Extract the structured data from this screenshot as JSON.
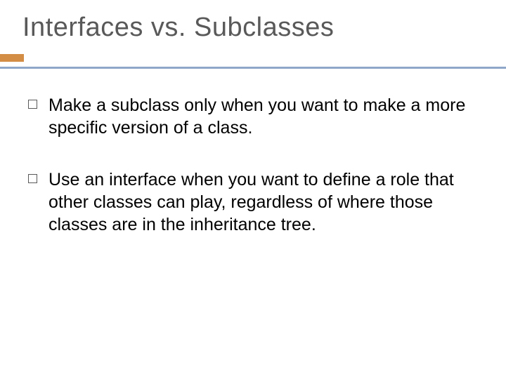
{
  "slide": {
    "title": "Interfaces vs. Subclasses",
    "bullets": [
      {
        "text": "Make a subclass only when you want to make a more specific version of a class."
      },
      {
        "text": "Use an interface when you want to define a role that other classes can play, regardless of where those classes are in the inheritance tree."
      }
    ]
  }
}
